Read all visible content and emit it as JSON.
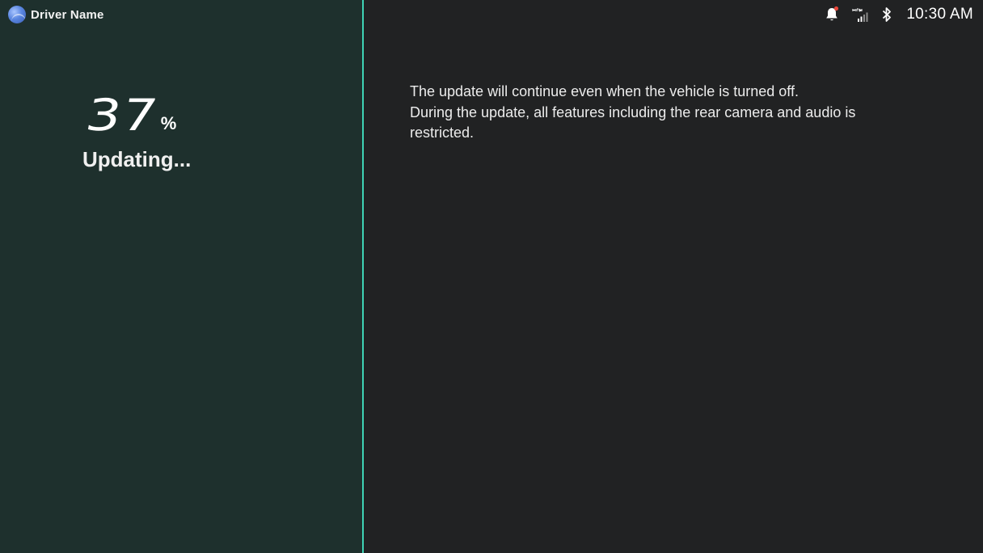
{
  "header": {
    "driver_name": "Driver Name",
    "icons": [
      "avatar",
      "bell-icon",
      "signal-icon",
      "bluetooth-icon"
    ],
    "time": "10:30 AM",
    "notification_dot_color": "#e8463a"
  },
  "update": {
    "progress_percent": "37",
    "percent_symbol": "%",
    "status": "Updating..."
  },
  "message": {
    "line1": "The update will continue even when the vehicle is turned off.",
    "line2": "During the update, all features including the rear camera and audio is restricted."
  },
  "colors": {
    "left_panel": "#1e302d",
    "right_panel": "#212223",
    "divider": "#3fd2b4"
  }
}
